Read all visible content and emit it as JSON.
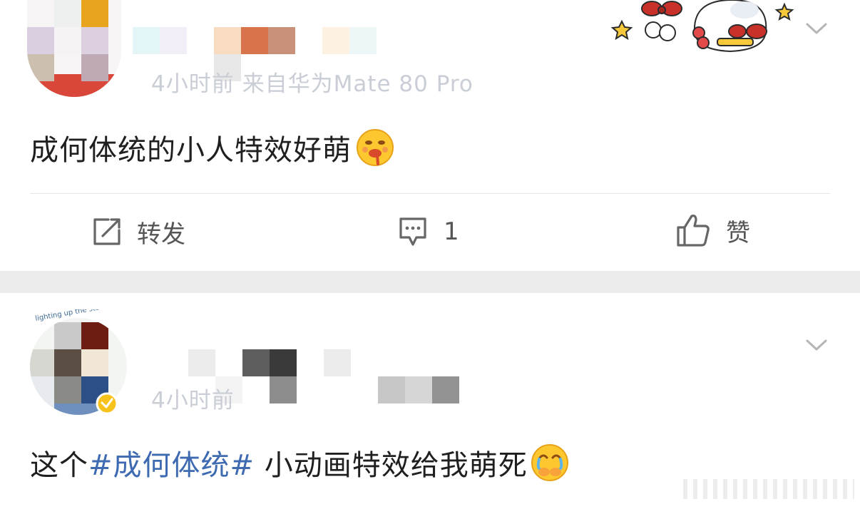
{
  "post1": {
    "meta_line": "4小时前 来自华为Mate 80 Pro",
    "content": "成何体统的小人特效好萌",
    "actions": {
      "repost_label": "转发",
      "comment_count": "1",
      "like_label": "赞"
    }
  },
  "post2": {
    "meta_line": "4小时前",
    "content_prefix": "这个",
    "hashtag": "#成何体统#",
    "content_suffix": " 小动画特效给我萌死",
    "avatar_caption": "lighting up the stars"
  },
  "colors": {
    "accent_link": "#3e6ab1",
    "separator": "#ececec",
    "icon_gray": "#666666"
  },
  "icons": [
    "chevron-down-icon",
    "repost-icon",
    "comment-icon",
    "like-icon",
    "verified-badge-icon",
    "emoji-drool",
    "emoji-tears"
  ]
}
